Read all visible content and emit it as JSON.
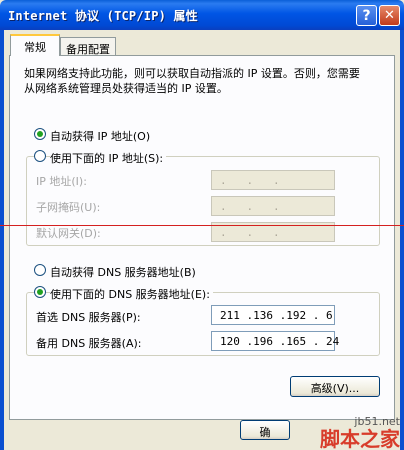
{
  "window": {
    "title": "Internet 协议 (TCP/IP) 属性",
    "help_label": "?",
    "close_label": "✕"
  },
  "tabs": [
    {
      "label": "常规"
    },
    {
      "label": "备用配置"
    }
  ],
  "intro_text": "如果网络支持此功能，则可以获取自动指派的 IP 设置。否则，您需要从网络系统管理员处获得适当的 IP 设置。",
  "ip": {
    "auto_label": "自动获得 IP 地址(O)",
    "manual_label": "使用下面的 IP 地址(S):",
    "fields": [
      {
        "label": "IP 地址(I):",
        "value": ".   .   ."
      },
      {
        "label": "子网掩码(U):",
        "value": ".   .   ."
      },
      {
        "label": "默认网关(D):",
        "value": ".   .   ."
      }
    ]
  },
  "dns": {
    "auto_label": "自动获得 DNS 服务器地址(B)",
    "manual_label": "使用下面的 DNS 服务器地址(E):",
    "preferred_label": "首选 DNS 服务器(P):",
    "preferred_value": "211 .136 .192 . 6",
    "alternate_label": "备用 DNS 服务器(A):",
    "alternate_value": "120 .196 .165 . 24"
  },
  "buttons": {
    "advanced": "高级(V)...",
    "ok_partial": "确"
  },
  "watermark": {
    "site": "jb51.net",
    "brand": "脚本之家"
  }
}
